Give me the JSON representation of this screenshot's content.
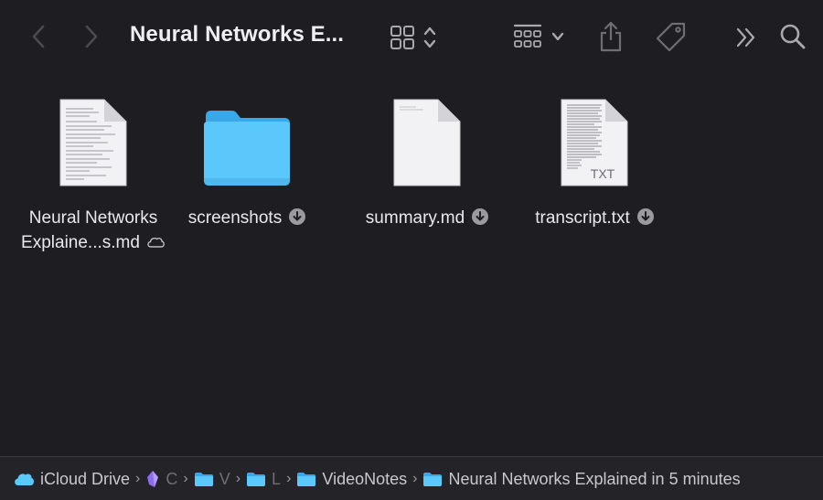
{
  "window": {
    "title": "Neural Networks E..."
  },
  "toolbar": {
    "back_icon": "chevron-left-icon",
    "forward_icon": "chevron-right-icon",
    "view_icon": "grid-view-icon",
    "group_icon": "group-by-icon",
    "share_icon": "share-icon",
    "tag_icon": "tag-icon",
    "more_icon": "more-chevrons-icon",
    "search_icon": "search-icon"
  },
  "files": [
    {
      "line1": "Neural Networks",
      "line2": "Explaine...s.md",
      "kind": "document",
      "status": "cloud"
    },
    {
      "line1": "screenshots",
      "line2": "",
      "kind": "folder",
      "status": "download"
    },
    {
      "line1": "summary.md",
      "line2": "",
      "kind": "blank-document",
      "status": "download"
    },
    {
      "line1": "transcript.txt",
      "line2": "",
      "kind": "txt-document",
      "badge": "TXT",
      "status": "download"
    }
  ],
  "pathbar": {
    "crumbs": [
      {
        "label": "iCloud Drive",
        "icon": "icloud-icon"
      },
      {
        "label": "C",
        "icon": "app-icon",
        "dim": true
      },
      {
        "label": "V",
        "icon": "folder-icon",
        "dim": true
      },
      {
        "label": "L",
        "icon": "folder-icon",
        "dim": true
      },
      {
        "label": "VideoNotes",
        "icon": "folder-icon"
      },
      {
        "label": "Neural Networks Explained in 5 minutes",
        "icon": "folder-icon"
      }
    ],
    "separator": "›"
  },
  "colors": {
    "background": "#1e1e22",
    "folder": "#5ac8fa",
    "folder_tab": "#3aa8e8"
  }
}
